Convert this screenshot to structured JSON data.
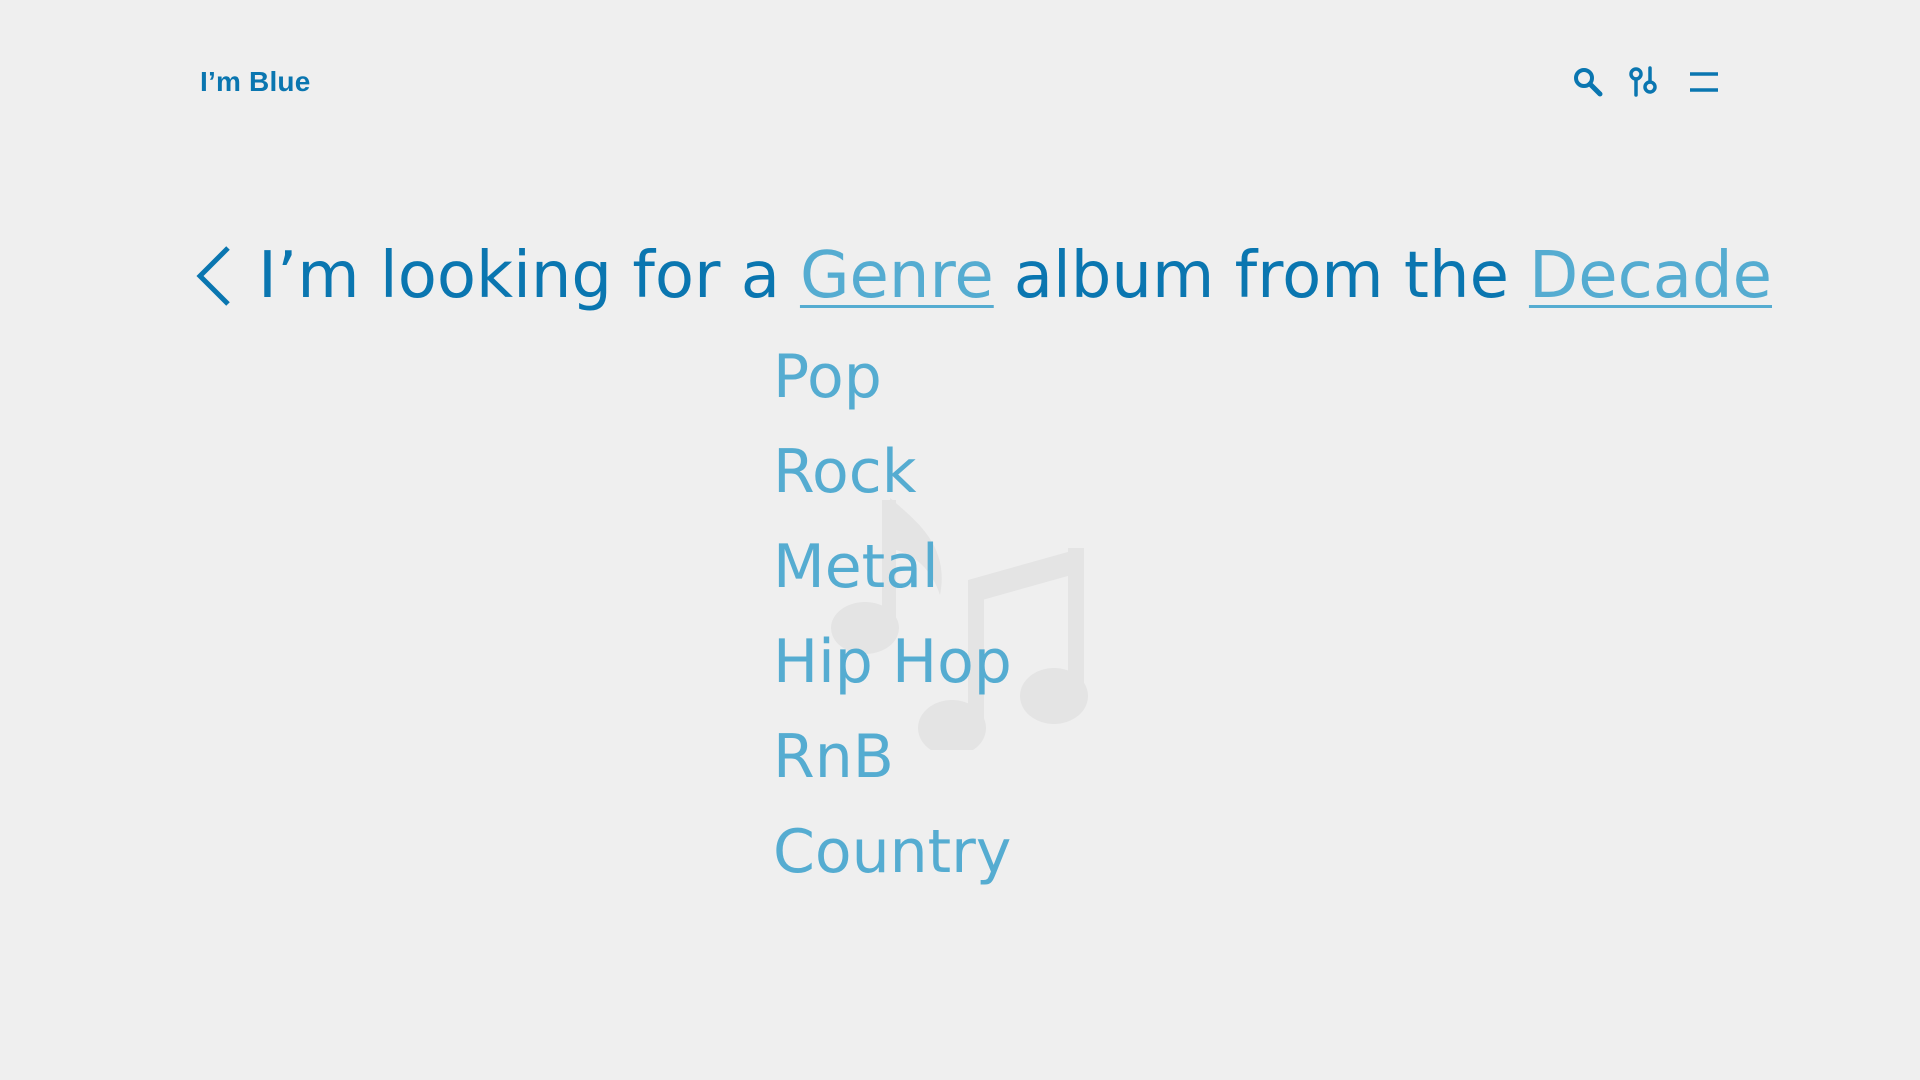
{
  "brand": {
    "logo_text": "I’m Blue"
  },
  "toolbar": {
    "icons": [
      "search-icon",
      "filter-icon",
      "menu-icon"
    ]
  },
  "sentence": {
    "prefix": "I’m looking for a",
    "genre_label": "Genre",
    "middle": "album from the",
    "decade_label": "Decade"
  },
  "genre_options": [
    "Pop",
    "Rock",
    "Metal",
    "Hip Hop",
    "RnB",
    "Country"
  ],
  "colors": {
    "background": "#efefef",
    "primary": "#0a76b0",
    "accent_light": "#55acd1",
    "watermark": "#e4e4e4"
  }
}
